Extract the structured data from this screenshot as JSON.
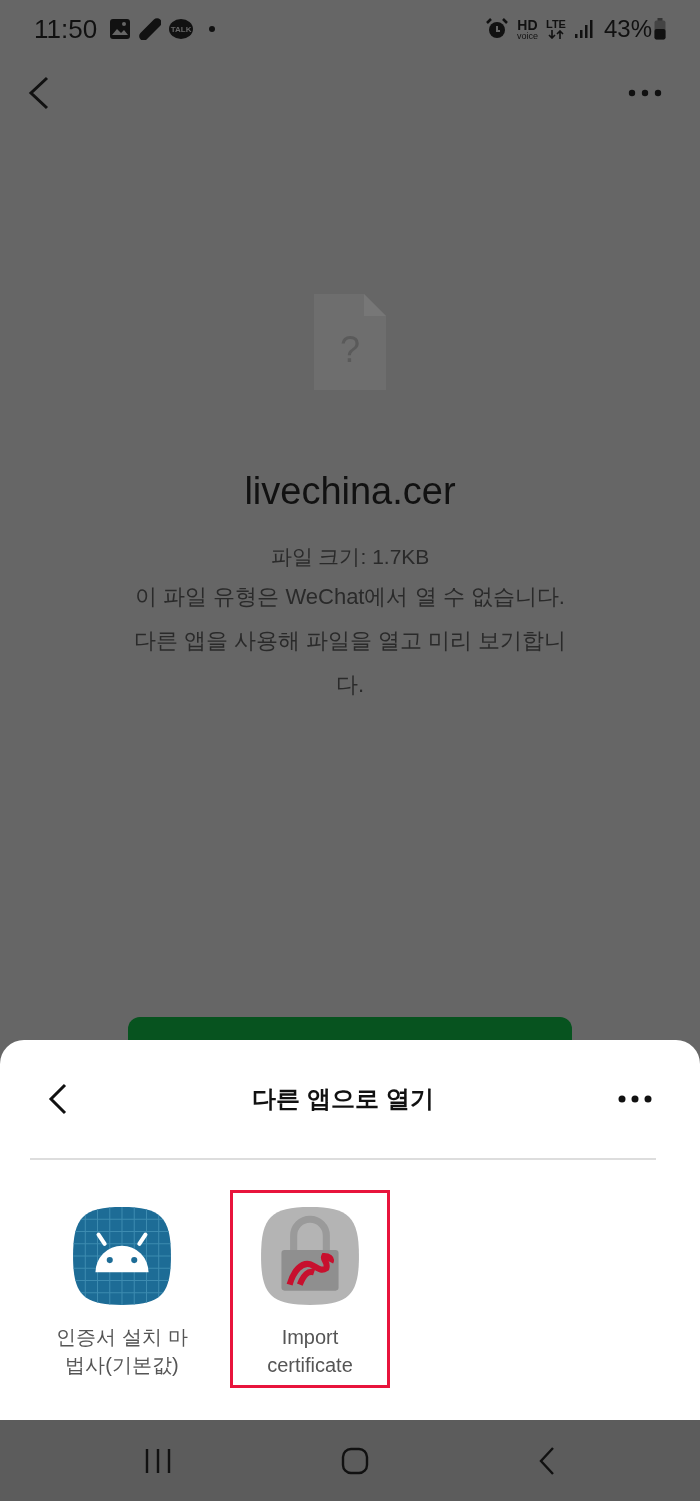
{
  "status_bar": {
    "time": "11:50",
    "talk_badge": "TALK",
    "hd": "HD",
    "voice": "voice",
    "network": "LTE",
    "battery": "43%"
  },
  "file": {
    "icon_glyph": "?",
    "name": "livechina.cer",
    "size": "파일 크기: 1.7KB",
    "message": "이 파일 유형은 WeChat에서 열 수 없습니다. 다른 앱을 사용해 파일을 열고 미리 보기합니다."
  },
  "sheet": {
    "title": "다른 앱으로 열기",
    "apps": [
      {
        "kind": "android",
        "label": "인증서 설치 마법사(기본값)",
        "highlighted": false
      },
      {
        "kind": "lock",
        "label": "Import certificate",
        "highlighted": true
      }
    ]
  }
}
